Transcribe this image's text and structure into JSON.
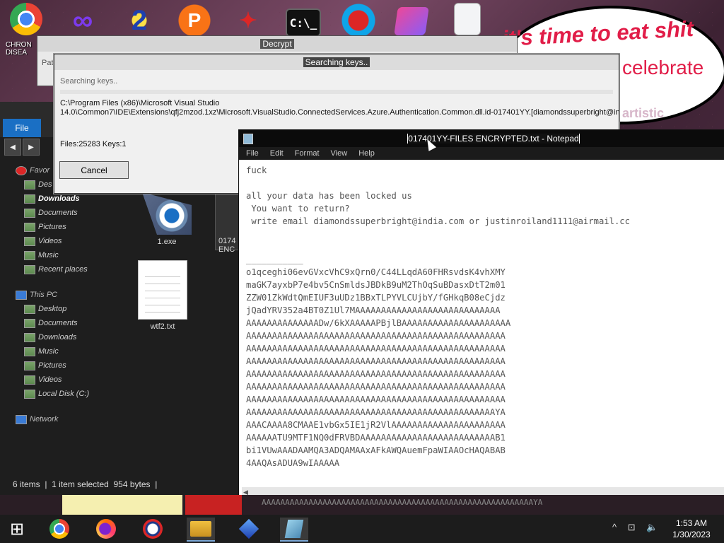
{
  "desktop": {
    "chrome_label": "CHRON\nDISEA",
    "banner": {
      "line1": "it's time to eat shit",
      "line2": "celebrate",
      "line3": "artistic"
    }
  },
  "decrypt_window": {
    "title": "Decrypt",
    "pat_label": "Pat"
  },
  "search_window": {
    "title": "Searching keys..",
    "status": "Searching keys..",
    "path": "C:\\Program Files (x86)\\Microsoft Visual Studio\n14.0\\Common7\\IDE\\Extensions\\qfj2mzod.1xz\\Microsoft.VisualStudio.ConnectedServices.Azure.Authentication.Common.dll.id-017401YY.[diamondssuperbright@india",
    "counts": "Files:25283 Keys:1",
    "cancel_label": "Cancel"
  },
  "explorer": {
    "file_tab": "File",
    "tree": [
      {
        "label": "Favor",
        "type": "head"
      },
      {
        "label": "Des",
        "type": "item"
      },
      {
        "label": "Downloads",
        "type": "selected"
      },
      {
        "label": "Documents",
        "type": "item"
      },
      {
        "label": "Pictures",
        "type": "item"
      },
      {
        "label": "Videos",
        "type": "item"
      },
      {
        "label": "Music",
        "type": "item"
      },
      {
        "label": "Recent places",
        "type": "item"
      },
      {
        "label": "This PC",
        "type": "head"
      },
      {
        "label": "Desktop",
        "type": "item"
      },
      {
        "label": "Documents",
        "type": "item"
      },
      {
        "label": "Downloads",
        "type": "item"
      },
      {
        "label": "Music",
        "type": "item"
      },
      {
        "label": "Pictures",
        "type": "item"
      },
      {
        "label": "Videos",
        "type": "item"
      },
      {
        "label": "Local Disk (C:)",
        "type": "item"
      },
      {
        "label": "Network",
        "type": "head"
      }
    ],
    "files": [
      {
        "label": "1.exe"
      },
      {
        "label": "wtf2.txt"
      },
      {
        "label": "0174\nENC"
      }
    ],
    "status": "6 items  |  1 item selected  954 bytes  |"
  },
  "notepad": {
    "title": "017401YY-FILES ENCRYPTED.txt - Notepad",
    "menu": [
      "File",
      "Edit",
      "Format",
      "View",
      "Help"
    ],
    "text": "fuck\n\nall your data has been locked us\n You want to return?\n write email diamondssuperbright@india.com or justinroiland1111@airmail.cc\n\n\n___________\no1qceghi06evGVxcVhC9xQrn0/C44LLqdA60FHRsvdsK4vhXMY\nmaGK7ayxbP7e4bv5CnSmldsJBDkB9uM2ThOqSuBDasxDtT2m01\nZZW01ZkWdtQmEIUF3uUDz1BBxTLPYVLCUjbY/fGHkqB08eCjdz\njQadYRV352a4BT0Z1Ul7MAAAAAAAAAAAAAAAAAAAAAAAAAAAA\nAAAAAAAAAAAAAADw/6kXAAAAAPBjlBAAAAAAAAAAAAAAAAAAAAA\nAAAAAAAAAAAAAAAAAAAAAAAAAAAAAAAAAAAAAAAAAAAAAAAAAA\nAAAAAAAAAAAAAAAAAAAAAAAAAAAAAAAAAAAAAAAAAAAAAAAAAA\nAAAAAAAAAAAAAAAAAAAAAAAAAAAAAAAAAAAAAAAAAAAAAAAAAA\nAAAAAAAAAAAAAAAAAAAAAAAAAAAAAAAAAAAAAAAAAAAAAAAAAA\nAAAAAAAAAAAAAAAAAAAAAAAAAAAAAAAAAAAAAAAAAAAAAAAAAA\nAAAAAAAAAAAAAAAAAAAAAAAAAAAAAAAAAAAAAAAAAAAAAAAAAA\nAAAAAAAAAAAAAAAAAAAAAAAAAAAAAAAAAAAAAAAAAAAAAAAAYA\nAAACAAAA8CMAAE1vbGx5IE1jR2VlAAAAAAAAAAAAAAAAAAAAAA\nAAAAAATU9MTF1NQ0dFRVBDAAAAAAAAAAAAAAAAAAAAAAAAAAB1\nbi1VUwAAADAAMQA3ADQAMAAxAFkAWQAuemFpaWIAAOcHAQABAB\n4AAQAsADUA9wIAAAAA"
  },
  "bleed_text": "AAAAAAAAAAAAAAAAAAAAAAAAAAAAAAAAAAAAAAAAAAAAAAAAAAAAAAAAAAYA",
  "taskbar": {
    "time": "1:53 AM",
    "date": "1/30/2023",
    "tray": "^ ⊡ 🔈"
  },
  "colors": {
    "accent": "#1a6fc4",
    "banner_text": "#e11d48",
    "explorer_bg": "#1e1e1e",
    "notepad_titlebar": "#0b0b0b"
  }
}
